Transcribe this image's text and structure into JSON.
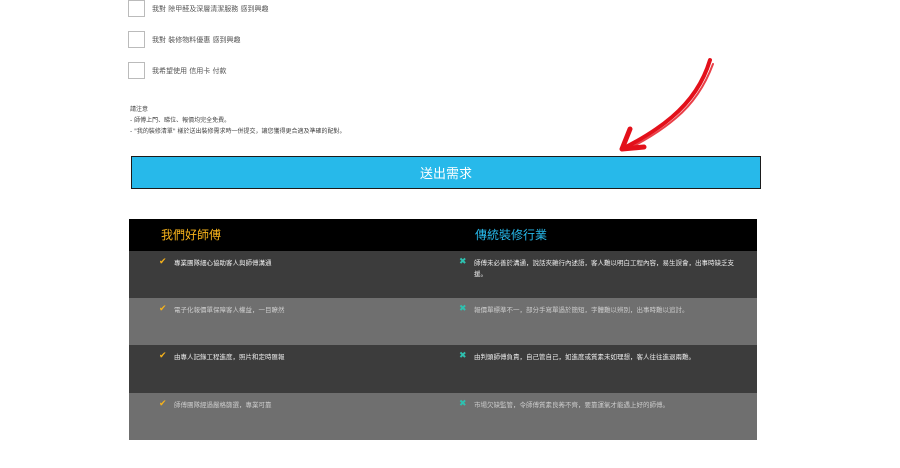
{
  "options": [
    {
      "label": "我對 除甲醛及深層清潔服務 感到興趣"
    },
    {
      "label": "我對 裝修物料優惠 感到興趣"
    },
    {
      "label": "我希望使用 信用卡 付款"
    }
  ],
  "notes": {
    "title": "請注意",
    "lines": [
      "- 師傅上門、睇位、報價均完全免費。",
      "- \"我的裝修清單\" 樣於送出裝修需求時一併提交，讓您獲得更合適及準確的配對。"
    ]
  },
  "submit_label": "送出需求",
  "comparison": {
    "left_title": "我們好師傅",
    "right_title": "傳統裝修行業",
    "rows": [
      {
        "left": "專業團隊細心協助客人與師傅溝通",
        "right": "師傅未必善於溝通，說話夾雜行內述語，客人難以明白工程內容，易生誤會，出事時缺乏支援。"
      },
      {
        "left": "電子化報價單保障客人權益，一目瞭然",
        "right": "報價單標準不一，部分手寫單過於簡短，字體難以辨別，出事時難以追討。"
      },
      {
        "left": "由專人記錄工程進度，照片和定時匯報",
        "right": "由判頭師傅負責，自己管自己，如進度或質素未如理想，客人往往進退兩難。"
      },
      {
        "left": "師傅團隊經過嚴格篩選，專業可靠",
        "right": "市場欠缺監管，令師傅質素良莠不齊，要靠運氣才能遇上好的師傅。"
      }
    ]
  },
  "colors": {
    "accent_blue": "#27b9ea",
    "accent_yellow": "#f6b21b",
    "arrow_red": "#e3101a"
  }
}
